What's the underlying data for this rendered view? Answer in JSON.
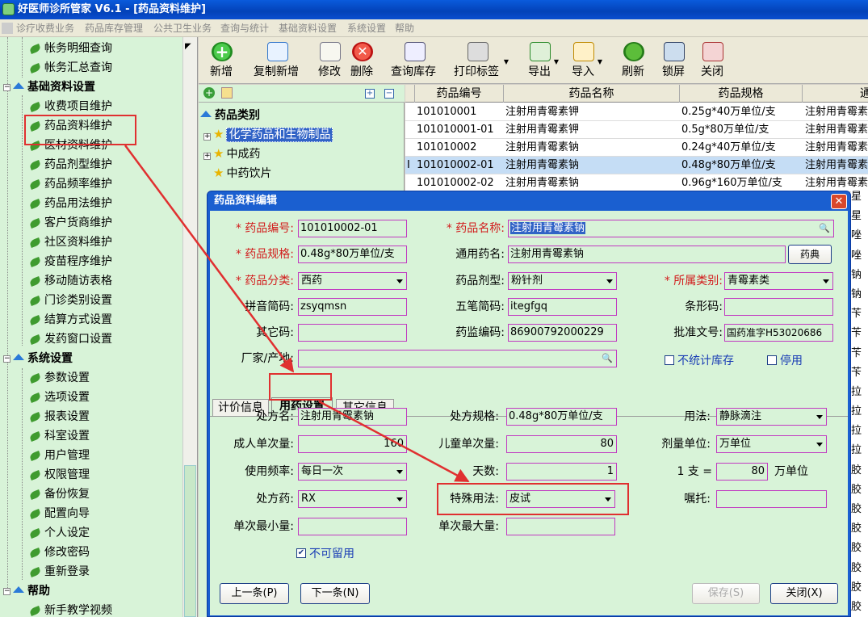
{
  "window": {
    "title": "好医师诊所管家 V6.1 - [药品资料维护]"
  },
  "menu": [
    "诊疗收费业务",
    "药品库存管理",
    "公共卫生业务",
    "查询与统计",
    "基础资料设置",
    "系统设置",
    "帮助"
  ],
  "sidebar": {
    "items_top": [
      "帐务明细查询",
      "帐务汇总查询"
    ],
    "group_basic": "基础资料设置",
    "basic_items": [
      "收费项目维护",
      "药品资料维护",
      "医材资料维护",
      "药品剂型维护",
      "药品频率维护",
      "药品用法维护",
      "客户货商维护",
      "社区资料维护",
      "疫苗程序维护",
      "移动随访表格",
      "门诊类别设置",
      "结算方式设置",
      "发药窗口设置"
    ],
    "group_system": "系统设置",
    "system_items": [
      "参数设置",
      "选项设置",
      "报表设置",
      "科室设置",
      "用户管理",
      "权限管理",
      "备份恢复",
      "配置向导",
      "个人设定",
      "修改密码",
      "重新登录"
    ],
    "group_help": "帮助",
    "help_items": [
      "新手教学视频"
    ]
  },
  "toolbar": [
    "新增",
    "复制新增",
    "修改",
    "删除",
    "查询库存",
    "打印标签",
    "导出",
    "导入",
    "刷新",
    "锁屏",
    "关闭"
  ],
  "category": {
    "title": "药品类别",
    "nodes": [
      "化学药品和生物制品",
      "中成药",
      "中药饮片"
    ]
  },
  "grid": {
    "headers": [
      "药品编号",
      "药品名称",
      "药品规格",
      "通"
    ],
    "rows": [
      [
        "101010001",
        "注射用青霉素钾",
        "0.25g*40万单位/支",
        "注射用青霉素"
      ],
      [
        "101010001-01",
        "注射用青霉素钾",
        "0.5g*80万单位/支",
        "注射用青霉素"
      ],
      [
        "101010002",
        "注射用青霉素钠",
        "0.24g*40万单位/支",
        "注射用青霉素"
      ],
      [
        "101010002-01",
        "注射用青霉素钠",
        "0.48g*80万单位/支",
        "注射用青霉素"
      ],
      [
        "101010002-02",
        "注射用青霉素钠",
        "0.96g*160万单位/支",
        "注射用青霉素"
      ]
    ],
    "row_marker": "I",
    "right_column": [
      "星",
      "星",
      "唑",
      "唑",
      "钠",
      "钠",
      "苄",
      "苄",
      "苄",
      "苄",
      "拉",
      "拉",
      "拉",
      "拉",
      "胶",
      "胶",
      "胶",
      "胶",
      "胶",
      "胶",
      "胶",
      "胶"
    ]
  },
  "dialog": {
    "title": "药品资料编辑",
    "close_icon": "✕",
    "fields": {
      "code_label": "药品编号:",
      "code_value": "101010002-01",
      "name_label": "药品名称:",
      "name_value": "注射用青霉素钠",
      "spec_label": "药品规格:",
      "spec_value": "0.48g*80万单位/支",
      "generic_label": "通用药名:",
      "generic_value": "注射用青霉素钠",
      "dict_button": "药典",
      "category_label": "药品分类:",
      "category_value": "西药",
      "form_label": "药品剂型:",
      "form_value": "粉针剂",
      "class_label": "所属类别:",
      "class_value": "青霉素类",
      "pinyin_label": "拼音简码:",
      "pinyin_value": "zsyqmsn",
      "wubi_label": "五笔简码:",
      "wubi_value": "itegfgq",
      "barcode_label": "条形码:",
      "barcode_value": "",
      "other_code_label": "其它码:",
      "other_code_value": "",
      "regulator_code_label": "药监编码:",
      "regulator_code_value": "86900792000229",
      "approval_label": "批准文号:",
      "approval_value": "国药准字H53020686",
      "maker_label": "厂家/产地:",
      "maker_value": "",
      "no_stock_label": "不统计库存",
      "disabled_label": "停用"
    },
    "tabs": [
      "计价信息",
      "用药设置",
      "其它信息"
    ],
    "usage": {
      "rx_name_label": "处方名:",
      "rx_name_value": "注射用青霉素钠",
      "rx_spec_label": "处方规格:",
      "rx_spec_value": "0.48g*80万单位/支",
      "route_label": "用法:",
      "route_value": "静脉滴注",
      "adult_dose_label": "成人单次量:",
      "adult_dose_value": "160",
      "child_dose_label": "儿童单次量:",
      "child_dose_value": "80",
      "dose_unit_label": "剂量单位:",
      "dose_unit_value": "万单位",
      "freq_label": "使用频率:",
      "freq_value": "每日一次",
      "days_label": "天数:",
      "days_value": "1",
      "conv_prefix": "1 支 =",
      "conv_value": "80",
      "conv_unit": "万单位",
      "rx_drug_label": "处方药:",
      "rx_drug_value": "RX",
      "special_label": "特殊用法:",
      "special_value": "皮试",
      "advice_label": "嘱托:",
      "advice_value": "",
      "min_dose_label": "单次最小量:",
      "min_dose_value": "",
      "max_dose_label": "单次最大量:",
      "max_dose_value": "",
      "no_keep_label": "不可留用"
    },
    "buttons": {
      "prev": "上一条(P)",
      "next": "下一条(N)",
      "save": "保存(S)",
      "close": "关闭(X)"
    }
  },
  "colors": {
    "panel_green": "#d8f3d8",
    "dialog_blue": "#1a5fd0",
    "field_border": "#c13ac1",
    "required_red": "#d21c1c",
    "annotation_red": "#e03030"
  }
}
